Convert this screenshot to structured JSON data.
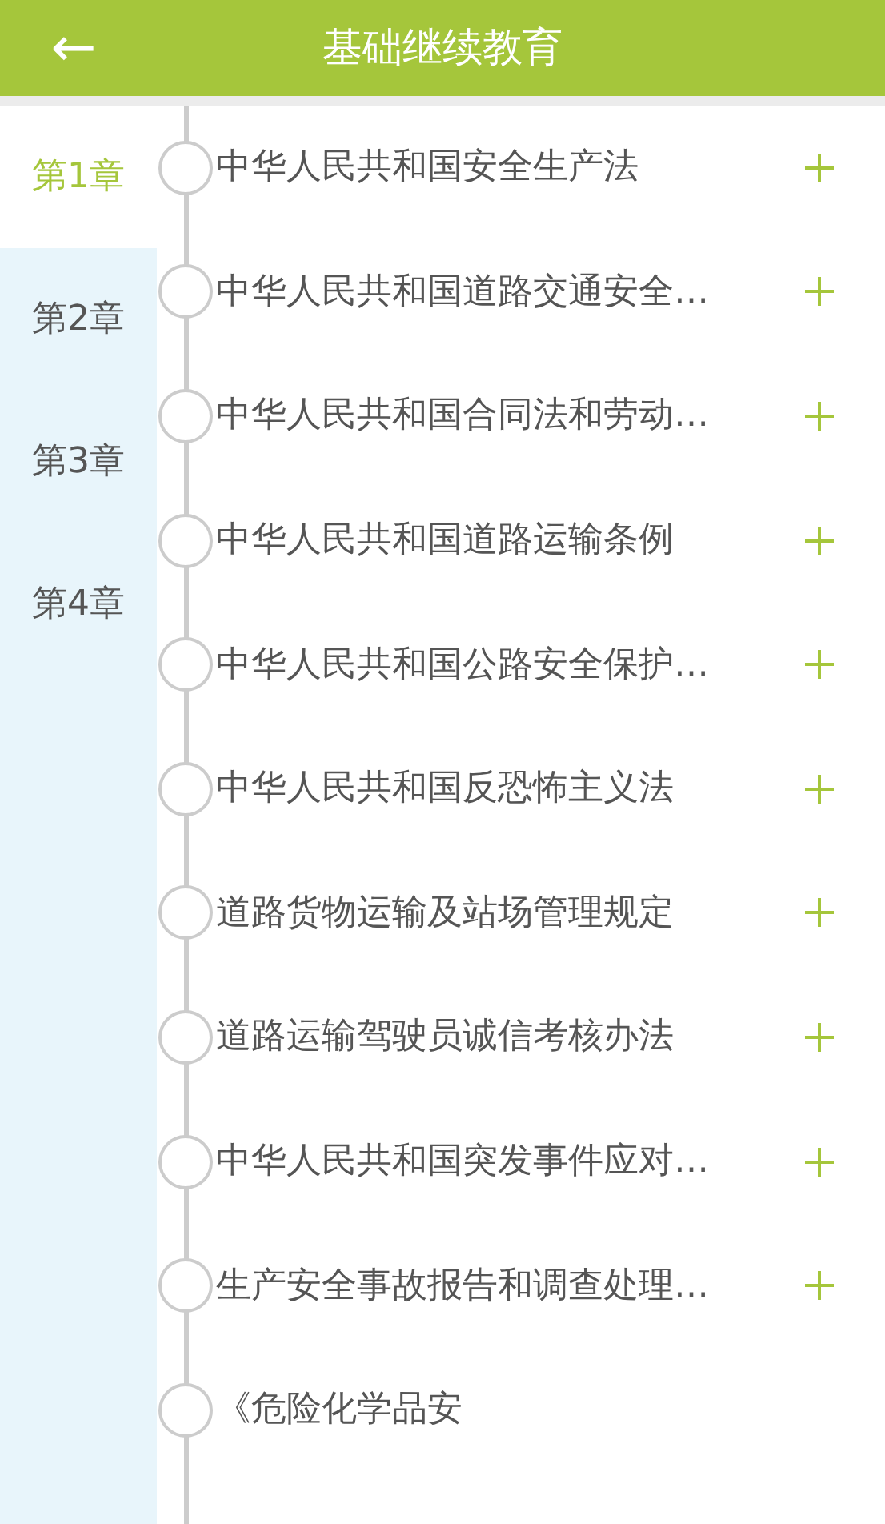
{
  "header": {
    "back_icon": "←",
    "title": "基础继续教育"
  },
  "chapters": [
    {
      "label": "第1章",
      "selected": true
    },
    {
      "label": "第2章",
      "selected": false
    },
    {
      "label": "第3章",
      "selected": false
    },
    {
      "label": "第4章",
      "selected": false
    }
  ],
  "sections": [
    {
      "title": "中华人民共和国安全生产法",
      "expandable": true
    },
    {
      "title": "中华人民共和国道路交通安全…",
      "expandable": true
    },
    {
      "title": "中华人民共和国合同法和劳动…",
      "expandable": true
    },
    {
      "title": "中华人民共和国道路运输条例",
      "expandable": true
    },
    {
      "title": "中华人民共和国公路安全保护…",
      "expandable": true
    },
    {
      "title": "中华人民共和国反恐怖主义法",
      "expandable": true
    },
    {
      "title": "道路货物运输及站场管理规定",
      "expandable": true
    },
    {
      "title": "道路运输驾驶员诚信考核办法",
      "expandable": true
    },
    {
      "title": "中华人民共和国突发事件应对…",
      "expandable": true
    },
    {
      "title": "生产安全事故报告和调查处理…",
      "expandable": true
    },
    {
      "title": "《危险化学品安",
      "expandable": false
    }
  ]
}
